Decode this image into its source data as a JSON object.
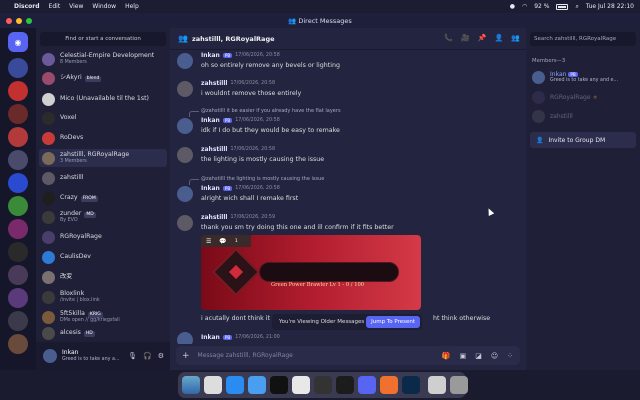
{
  "menubar": {
    "app_name": "Discord",
    "items": [
      "Edit",
      "View",
      "Window",
      "Help"
    ],
    "battery": "92 %",
    "clock": "Tue Jul 28  22:10"
  },
  "window": {
    "title": "Direct Messages"
  },
  "sidebar": {
    "search_label": "Find or start a conversation",
    "dms": [
      {
        "name": "Celestial-Empire Development",
        "sub": "8 Members",
        "color": "#6a5a9a"
      },
      {
        "name": "シAkyri",
        "tag": "blend",
        "color": "#9a4a6a"
      },
      {
        "name": "Mico (Unavailable til the 1st)",
        "color": "#d0d0d0"
      },
      {
        "name": "Voxel",
        "color": "#2b2b2b"
      },
      {
        "name": "RoDevs",
        "color": "#c93a3a"
      },
      {
        "name": "zahstilll, RGRoyalRage",
        "sub": "3 Members",
        "color": "#7a6a5a"
      },
      {
        "name": "zahstilll",
        "color": "#5d5a66"
      },
      {
        "name": "Crazy",
        "tag": "FROM",
        "color": "#1e1e1e"
      },
      {
        "name": "zunder",
        "tag": "MD",
        "sub": "By EVO",
        "color": "#3a3a3a"
      },
      {
        "name": "RGRoyalRage",
        "color": "#4a3f6b"
      },
      {
        "name": "CaulisDev",
        "color": "#2e7bd6"
      },
      {
        "name": "改変",
        "color": "#7a7070"
      },
      {
        "name": "Bloxlink",
        "sub": "/invite | blox.link",
        "color": "#3a3a3a"
      },
      {
        "name": "5ft5killa",
        "tag": "KRIG",
        "sub": "DMs open // gg/kriegsfall",
        "color": "#7a5a3a"
      },
      {
        "name": "alcesis",
        "tag": "HD",
        "color": "#4a4a4a"
      }
    ],
    "user": {
      "name": "Inkan",
      "status": "Greed is to take any a..."
    }
  },
  "chat": {
    "title": "zahstilll, RGRoyalRage",
    "messages": [
      {
        "author": "Inkan",
        "badge": "PB",
        "time": "17/06/2026, 20:58",
        "text": "oh so entirely remove any bevels or lighting"
      },
      {
        "author": "zahstilll",
        "time": "17/06/2026, 20:58",
        "text": "i wouldnt remove those entirely"
      },
      {
        "reply": "@zahstilll it be easier if you already have the flat layers",
        "author": "Inkan",
        "badge": "PB",
        "time": "17/06/2026, 20:58",
        "text": "idk if I do but they would be easy to remake"
      },
      {
        "author": "zahstilll",
        "time": "17/06/2026, 20:58",
        "text": "the lighting is mostly causing the issue"
      },
      {
        "reply": "@zahstilll the lighting is mostly causing the issue",
        "author": "Inkan",
        "badge": "PB",
        "time": "17/06/2026, 20:58",
        "text": "alright wich shall I remake first"
      },
      {
        "author": "zahstilll",
        "time": "17/06/2026, 20:59",
        "text": "thank you sm try doing this one and ill confirm if it fits better"
      },
      {
        "text": "i acutally dont think it",
        "text_tail": "ht think otherwise"
      },
      {
        "author": "Inkan",
        "badge": "PB",
        "time": "17/06/2026, 21:00"
      }
    ],
    "embed_caption": "Green Power Brawler Lv 1 - 0 / 100",
    "embed_count": "1",
    "jump_notice": "You're Viewing Older Messages",
    "jump_button": "Jump To Present",
    "composer_placeholder": "Message zahstilll, RGRoyalRage"
  },
  "members": {
    "search_placeholder": "Search zahstilll, RGRoyalRage",
    "header": "Members—3",
    "list": [
      {
        "name": "Inkan",
        "badge": "PB",
        "status": "Greed is to take any and e...",
        "color": "#4a5d8f"
      },
      {
        "name": "RGRoyalRage",
        "color": "#4a3f6b"
      },
      {
        "name": "zahstilll",
        "color": "#5d5a66"
      }
    ],
    "invite_label": "Invite to Group DM"
  }
}
